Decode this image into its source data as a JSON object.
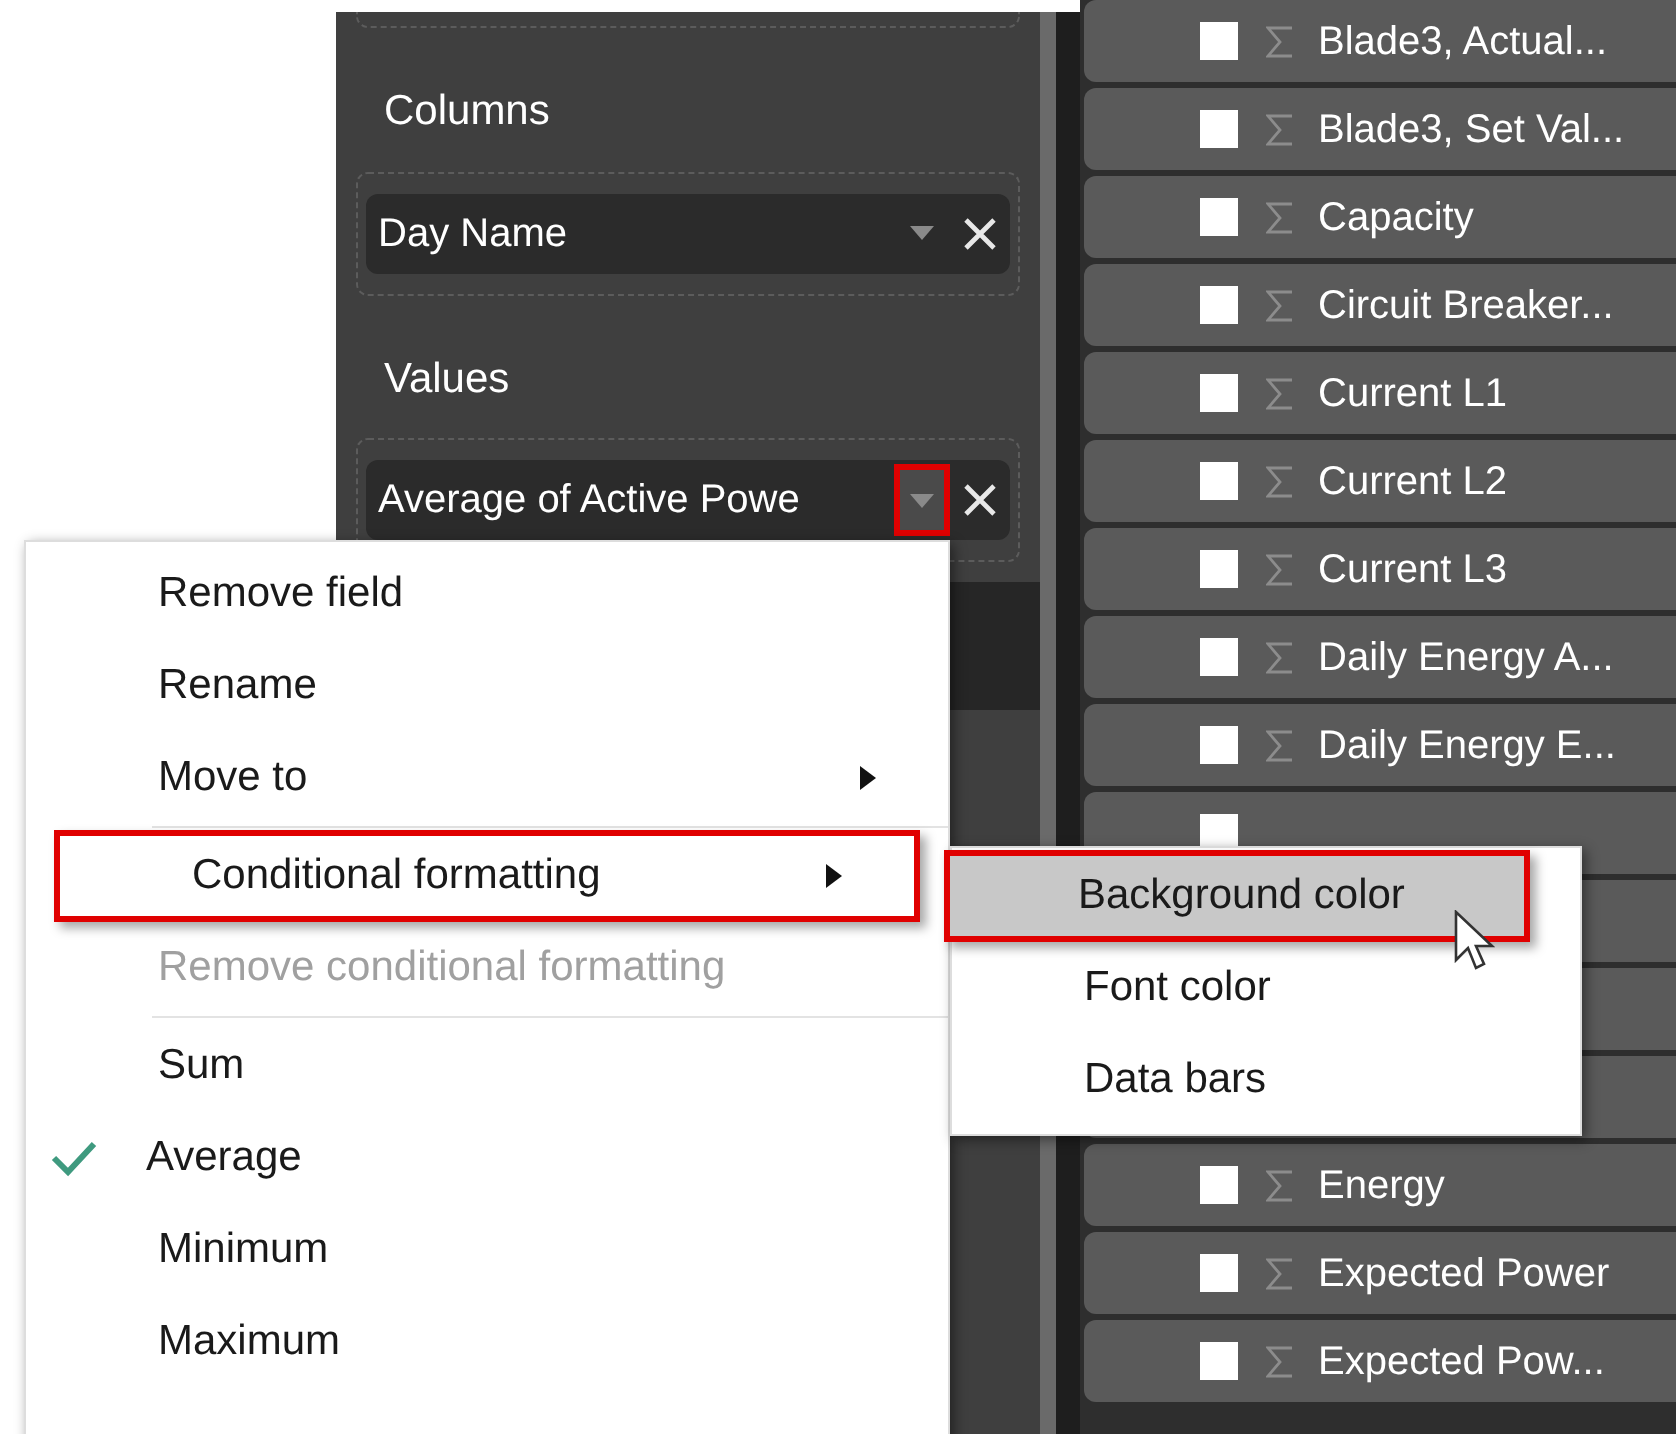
{
  "values_panel": {
    "sections": [
      {
        "title": "Columns",
        "fields": [
          {
            "label": "Day Name",
            "menu_open": false
          }
        ]
      },
      {
        "title": "Values",
        "fields": [
          {
            "label": "Average of Active Powe",
            "menu_open": true
          }
        ]
      }
    ]
  },
  "field_list": [
    {
      "label": "Blade3, Actual...",
      "checked": false
    },
    {
      "label": "Blade3, Set Val...",
      "checked": false
    },
    {
      "label": "Capacity",
      "checked": false
    },
    {
      "label": "Circuit Breaker...",
      "checked": false
    },
    {
      "label": "Current L1",
      "checked": false
    },
    {
      "label": "Current L2",
      "checked": false
    },
    {
      "label": "Current L3",
      "checked": false
    },
    {
      "label": "Daily Energy A...",
      "checked": false
    },
    {
      "label": "Daily Energy E...",
      "checked": false
    },
    {
      "kind": "field",
      "checked": false
    },
    {
      "kind": "covered"
    },
    {
      "kind": "covered"
    },
    {
      "kind": "covered"
    },
    {
      "label": "Energy",
      "checked": false
    },
    {
      "label": "Expected Power",
      "checked": false
    },
    {
      "label": "Expected Pow...",
      "checked": false
    }
  ],
  "context_menu": {
    "items": [
      {
        "kind": "item",
        "label": "Remove field",
        "has_submenu": false,
        "highlighted": false,
        "disabled": false,
        "checked": false
      },
      {
        "kind": "item",
        "label": "Rename",
        "has_submenu": false,
        "highlighted": false,
        "disabled": false,
        "checked": false
      },
      {
        "kind": "item",
        "label": "Move to",
        "has_submenu": true,
        "highlighted": false,
        "disabled": false,
        "checked": false
      },
      {
        "kind": "separator"
      },
      {
        "kind": "item",
        "label": "Conditional formatting",
        "has_submenu": true,
        "highlighted": true,
        "disabled": false,
        "checked": false
      },
      {
        "kind": "item",
        "label": "Remove conditional formatting",
        "has_submenu": false,
        "highlighted": false,
        "disabled": true,
        "checked": false
      },
      {
        "kind": "separator"
      },
      {
        "kind": "item",
        "label": "Sum",
        "has_submenu": false,
        "highlighted": false,
        "disabled": false,
        "checked": false
      },
      {
        "kind": "item",
        "label": "Average",
        "has_submenu": false,
        "highlighted": false,
        "disabled": false,
        "checked": true
      },
      {
        "kind": "item",
        "label": "Minimum",
        "has_submenu": false,
        "highlighted": false,
        "disabled": false,
        "checked": false
      },
      {
        "kind": "item",
        "label": "Maximum",
        "has_submenu": false,
        "highlighted": false,
        "disabled": false,
        "checked": false
      }
    ]
  },
  "submenu": {
    "items": [
      {
        "label": "Background color",
        "highlighted": true
      },
      {
        "label": "Font color",
        "highlighted": false
      },
      {
        "label": "Data bars",
        "highlighted": false
      }
    ]
  }
}
